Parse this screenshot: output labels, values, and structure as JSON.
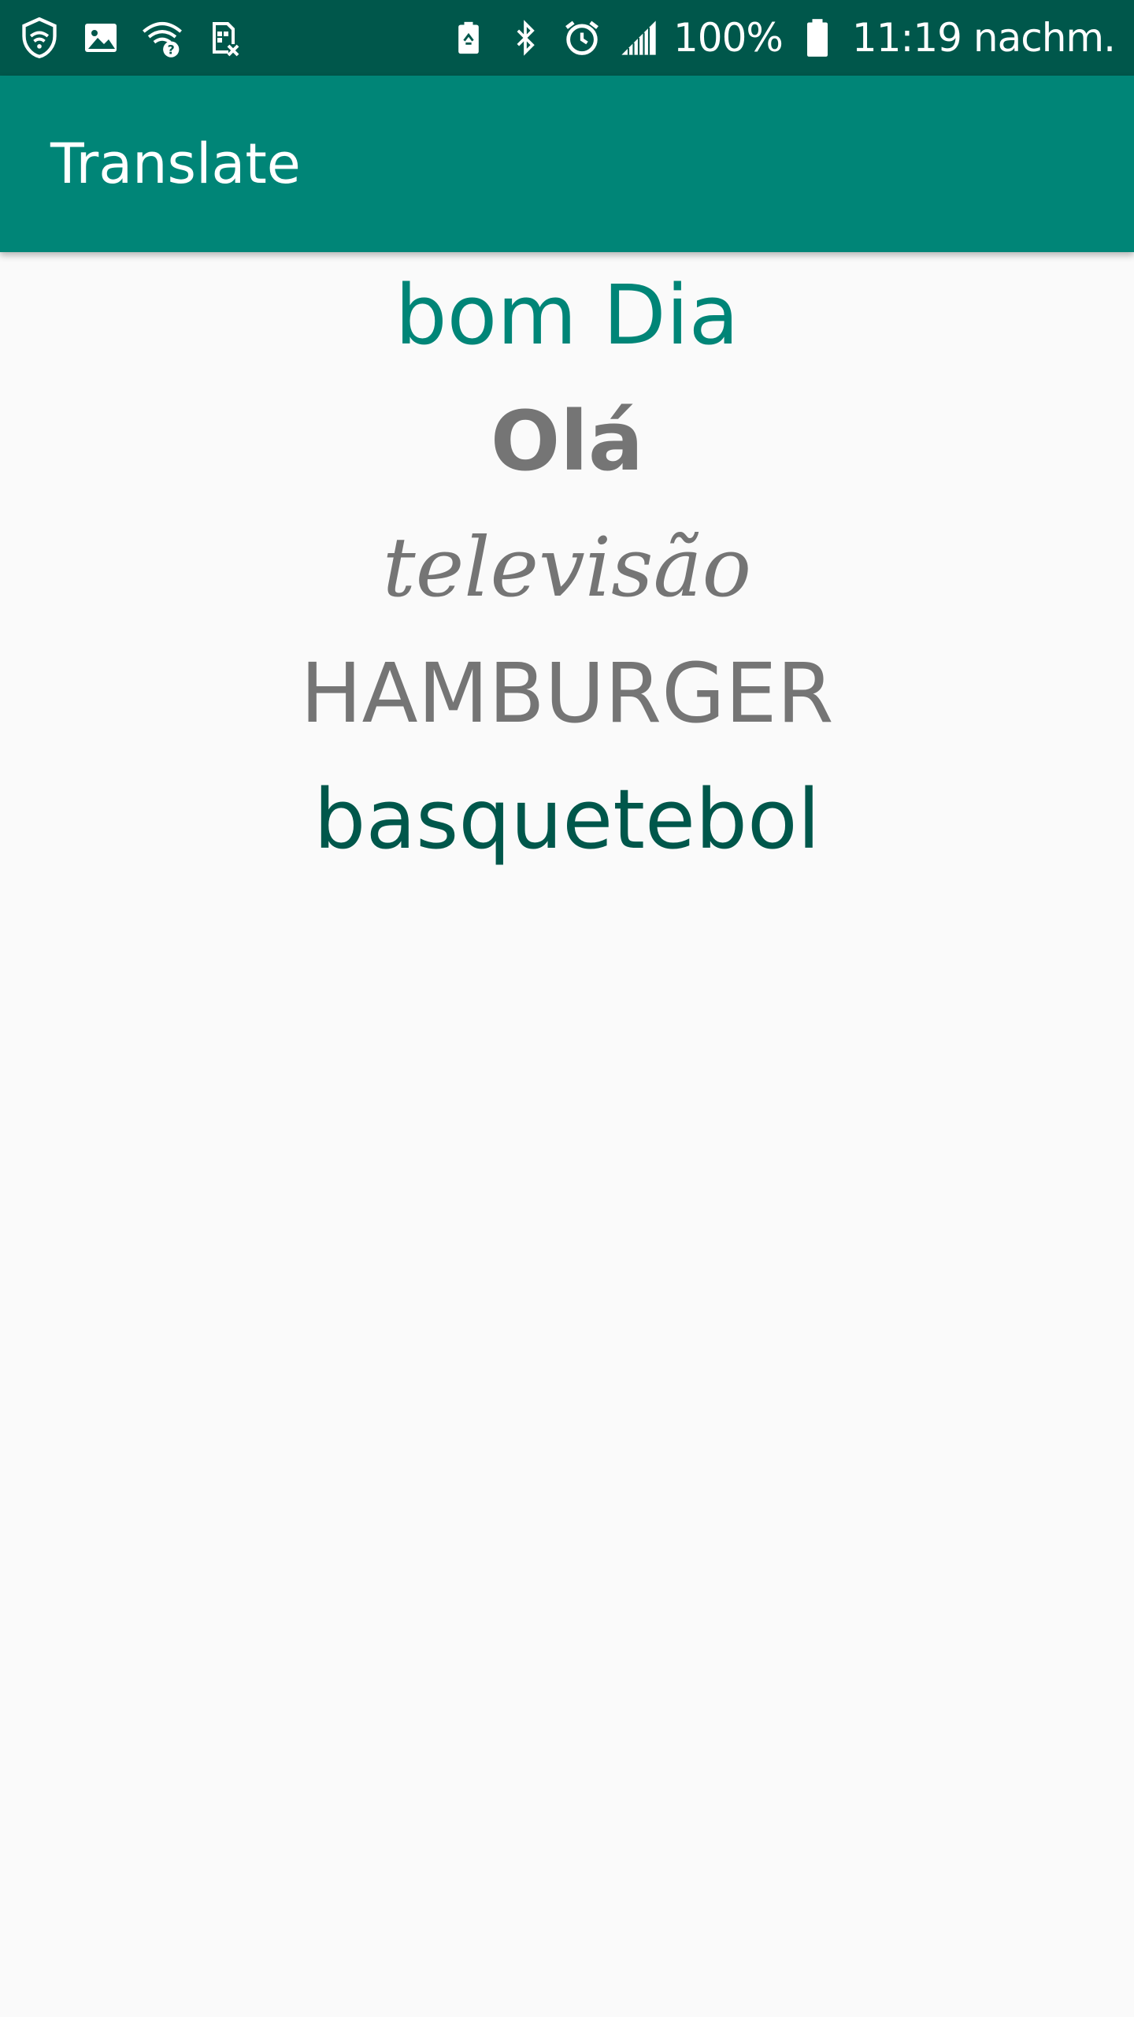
{
  "status_bar": {
    "battery_percent": "100%",
    "time": "11:19 nachm.",
    "icons_left": [
      "vpn-shield-icon",
      "image-icon",
      "wifi-unknown-icon",
      "sim-error-icon"
    ],
    "icons_right": [
      "battery-saver-icon",
      "bluetooth-icon",
      "alarm-icon",
      "signal-icon",
      "battery-icon"
    ],
    "background_color": "#00574B"
  },
  "app_bar": {
    "title": "Translate",
    "background_color": "#008577"
  },
  "words": [
    {
      "text": "bom Dia",
      "color": "#008577"
    },
    {
      "text": "Olá",
      "color": "#757575"
    },
    {
      "text": "televisão",
      "color": "#757575"
    },
    {
      "text": "HAMBURGER",
      "color": "#757575"
    },
    {
      "text": "basquetebol",
      "color": "#00574B"
    }
  ]
}
